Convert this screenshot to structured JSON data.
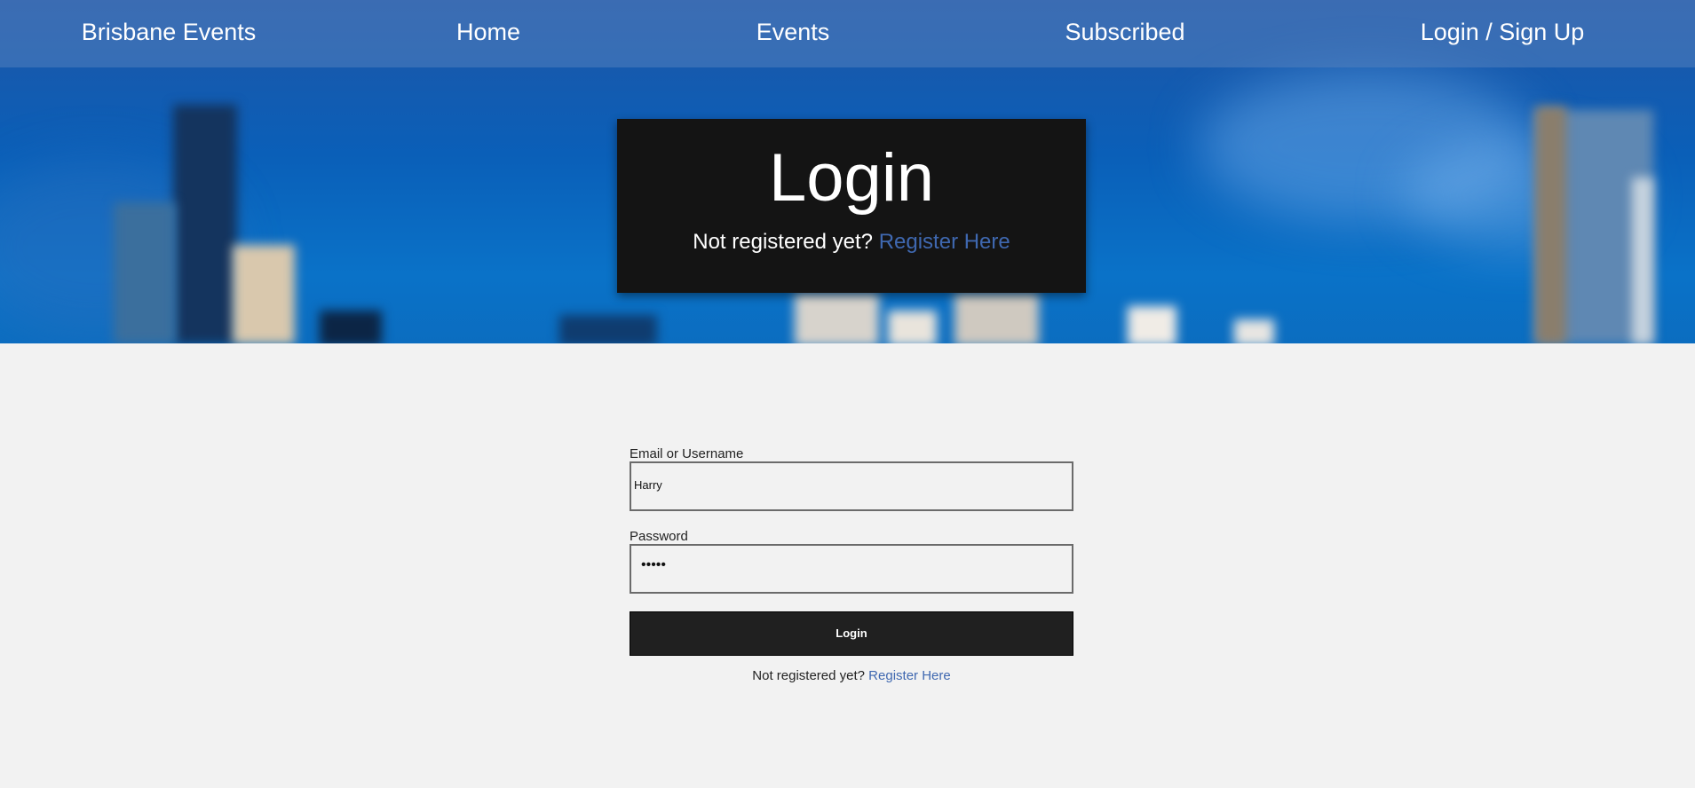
{
  "nav": {
    "brand": "Brisbane Events",
    "items": [
      {
        "label": "Home"
      },
      {
        "label": "Events"
      },
      {
        "label": "Subscribed"
      },
      {
        "label": "Login / Sign Up"
      }
    ]
  },
  "banner": {
    "title": "Login",
    "prompt": "Not registered yet?",
    "link": "Register Here"
  },
  "form": {
    "email_label": "Email or Username",
    "email_value": "Harry",
    "password_label": "Password",
    "password_value": "•••••",
    "submit_label": "Login",
    "footer_prompt": "Not registered yet?",
    "footer_link": "Register Here"
  },
  "colors": {
    "nav_overlay": "#527fbe",
    "banner_bg": "#141414",
    "link": "#3f68b0",
    "page_bg": "#f2f2f2",
    "button_bg": "#202020"
  }
}
